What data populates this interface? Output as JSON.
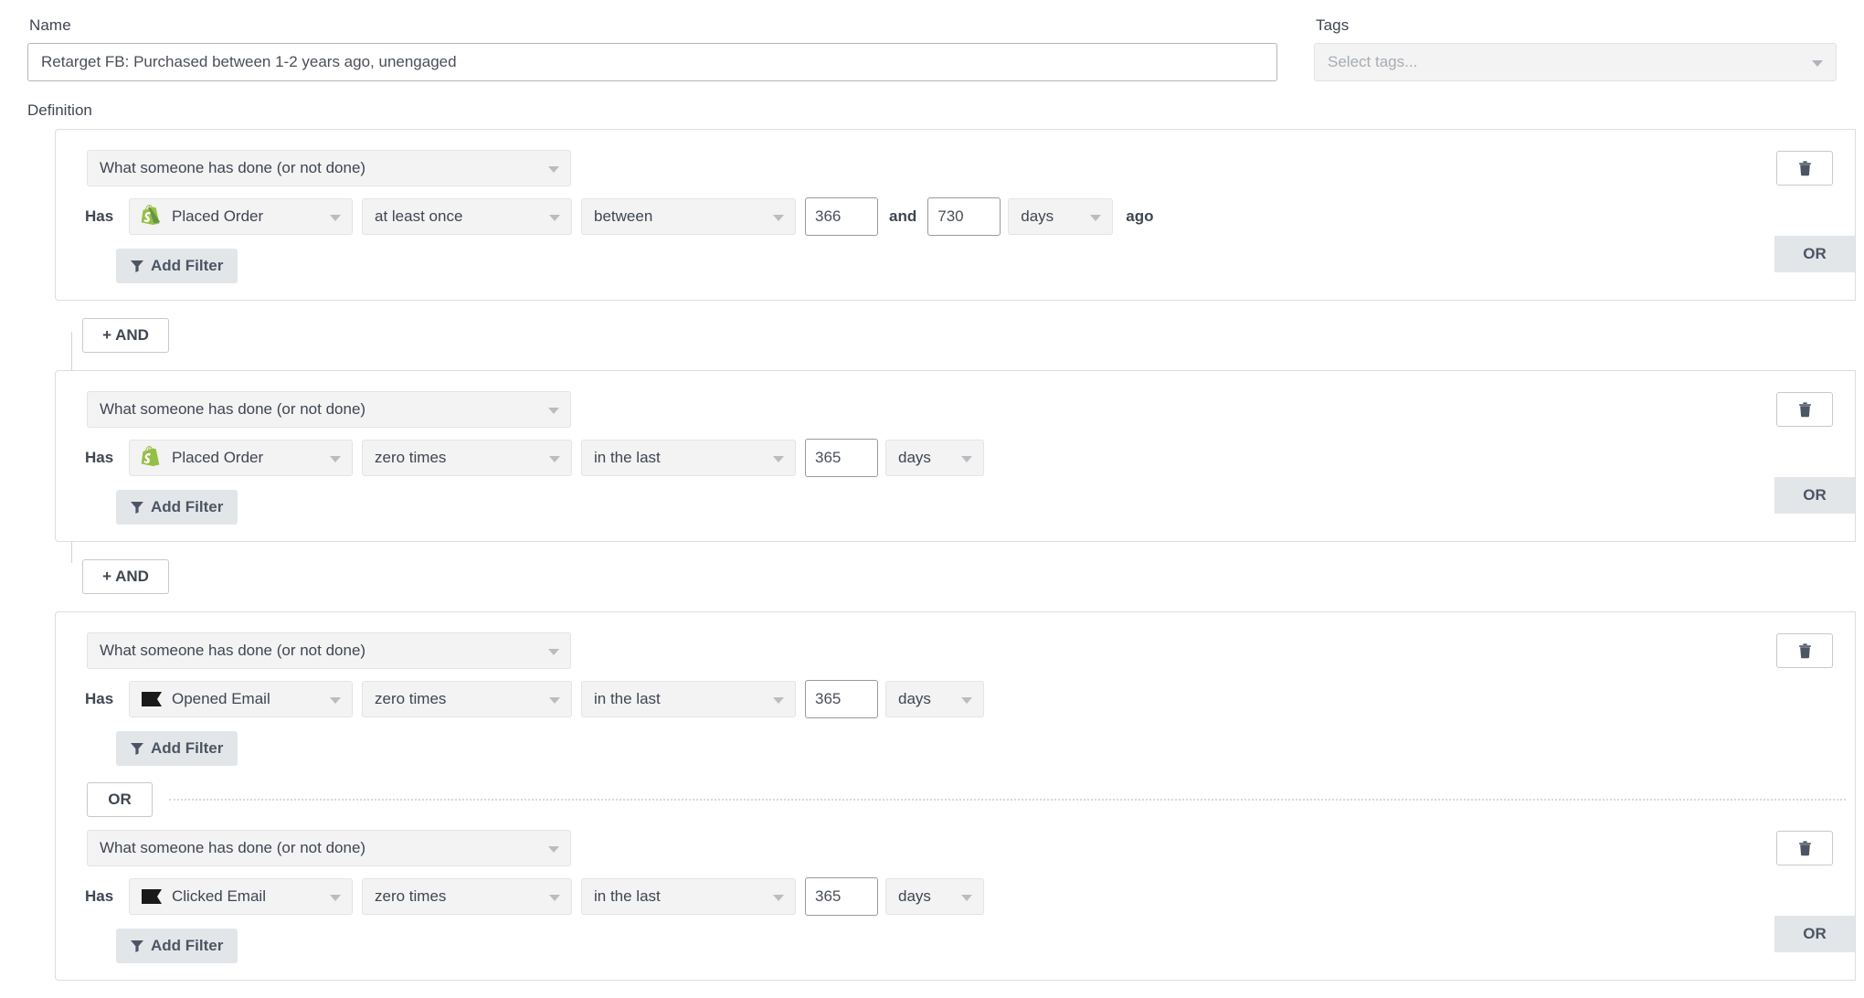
{
  "form": {
    "name_label": "Name",
    "name_value": "Retarget FB: Purchased between 1-2 years ago, unengaged",
    "tags_label": "Tags",
    "tags_placeholder": "Select tags...",
    "definition_label": "Definition"
  },
  "labels": {
    "has": "Has",
    "and_word": "and",
    "ago": "ago",
    "add_filter": "Add Filter",
    "or": "OR",
    "and_button": "+ AND",
    "type_select": "What someone has done (or not done)"
  },
  "icons": {
    "filter": "filter-icon",
    "trash": "trash-icon",
    "caret": "chevron-down-icon",
    "shopify": "shopify-icon",
    "klaviyo": "klaviyo-flag-icon"
  },
  "colors": {
    "shopify_green": "#95BF47",
    "klaviyo_black": "#1a1a1a",
    "button_gray": "#e3e6e9",
    "select_gray": "#f3f3f3"
  },
  "groups": [
    {
      "type": "What someone has done (or not done)",
      "conditions": [
        {
          "has": "Has",
          "metric_icon": "shopify-icon",
          "metric": "Placed Order",
          "operator": "at least once",
          "timeframe": "between",
          "value1": "366",
          "conj": "and",
          "value2": "730",
          "unit": "days",
          "suffix": "ago",
          "add_filter": "Add Filter"
        }
      ],
      "or_label": "OR"
    },
    {
      "type": "What someone has done (or not done)",
      "conditions": [
        {
          "has": "Has",
          "metric_icon": "shopify-icon",
          "metric": "Placed Order",
          "operator": "zero times",
          "timeframe": "in the last",
          "value1": "365",
          "unit": "days",
          "add_filter": "Add Filter"
        }
      ],
      "or_label": "OR"
    },
    {
      "type": "What someone has done (or not done)",
      "conditions": [
        {
          "has": "Has",
          "metric_icon": "klaviyo-flag-icon",
          "metric": "Opened Email",
          "operator": "zero times",
          "timeframe": "in the last",
          "value1": "365",
          "unit": "days",
          "add_filter": "Add Filter"
        },
        {
          "has": "Has",
          "metric_icon": "klaviyo-flag-icon",
          "metric": "Clicked Email",
          "operator": "zero times",
          "timeframe": "in the last",
          "value1": "365",
          "unit": "days",
          "add_filter": "Add Filter"
        }
      ],
      "inner_or": "OR",
      "or_label": "OR"
    }
  ],
  "and_buttons": [
    "+ AND",
    "+ AND"
  ]
}
